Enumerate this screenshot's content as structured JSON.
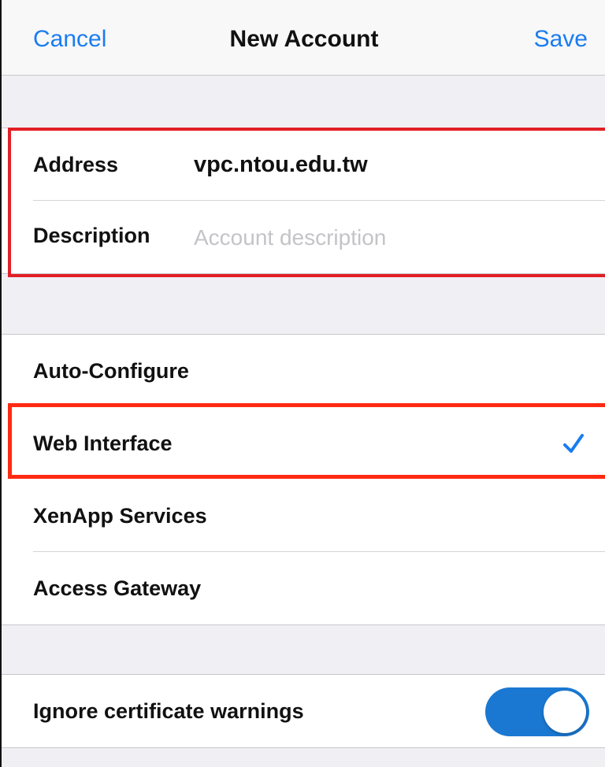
{
  "navbar": {
    "cancel_label": "Cancel",
    "title": "New Account",
    "save_label": "Save"
  },
  "account": {
    "address_label": "Address",
    "address_value": "vpc.ntou.edu.tw",
    "description_label": "Description",
    "description_placeholder": "Account description",
    "description_value": ""
  },
  "account_types": {
    "options": [
      "Auto-Configure",
      "Web Interface",
      "XenApp Services",
      "Access Gateway"
    ],
    "selected": "Web Interface"
  },
  "settings": {
    "ignore_cert_label": "Ignore certificate warnings",
    "ignore_cert_enabled": true
  },
  "colors": {
    "accent": "#1a7cf0",
    "toggle_on": "#1b78d2",
    "highlight_red": "#e21f26",
    "highlight_orange_red": "#ff2a12"
  },
  "icons": {
    "selected_marker": "checkmark-icon"
  }
}
